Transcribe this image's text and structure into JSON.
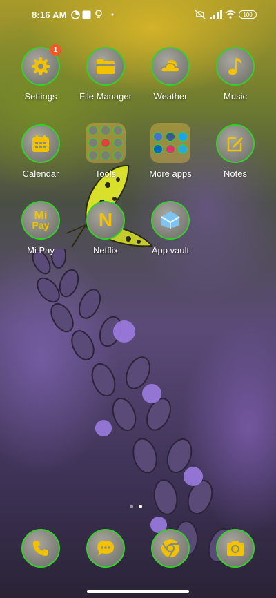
{
  "status_bar": {
    "time": "8:16 AM",
    "battery": "100",
    "icons": [
      "vpn-key-icon",
      "image-icon",
      "lightbulb-icon",
      "mute-icon",
      "signal-icon",
      "wifi-icon",
      "battery-icon"
    ]
  },
  "theme": {
    "accent": "#35d12a",
    "icon_glyph": "#f2c200",
    "badge": "#f05a2a"
  },
  "apps": {
    "settings": {
      "label": "Settings",
      "badge": "1",
      "icon": "gear-icon"
    },
    "file_manager": {
      "label": "File Manager",
      "icon": "folder-icon"
    },
    "weather": {
      "label": "Weather",
      "icon": "cloud-icon"
    },
    "music": {
      "label": "Music",
      "icon": "music-note-icon"
    },
    "calendar": {
      "label": "Calendar",
      "icon": "calendar-icon"
    },
    "tools": {
      "label": "Tools",
      "icon": "folder-icon"
    },
    "more_apps": {
      "label": "More apps",
      "icon": "folder-icon"
    },
    "notes": {
      "label": "Notes",
      "icon": "pencil-icon"
    },
    "mi_pay": {
      "label": "Mi Pay",
      "logo_line1": "Mi",
      "logo_line2": "Pay"
    },
    "netflix": {
      "label": "Netflix",
      "logo": "N"
    },
    "app_vault": {
      "label": "App vault",
      "icon": "app-vault-icon"
    }
  },
  "dock": [
    "phone-icon",
    "messaging-icon",
    "chrome-icon",
    "camera-icon"
  ],
  "pages": {
    "current": 2,
    "total": 2
  }
}
